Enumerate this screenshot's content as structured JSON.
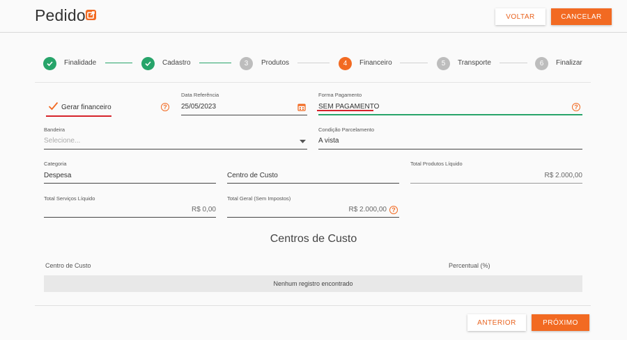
{
  "header": {
    "title": "Pedido",
    "back_label": "VOLTAR",
    "cancel_label": "CANCELAR"
  },
  "stepper": {
    "steps": [
      {
        "number": "1",
        "label": "Finalidade",
        "state": "done"
      },
      {
        "number": "2",
        "label": "Cadastro",
        "state": "done"
      },
      {
        "number": "3",
        "label": "Produtos",
        "state": "pending"
      },
      {
        "number": "4",
        "label": "Financeiro",
        "state": "active"
      },
      {
        "number": "5",
        "label": "Transporte",
        "state": "pending"
      },
      {
        "number": "6",
        "label": "Finalizar",
        "state": "pending"
      }
    ]
  },
  "form": {
    "gerar_financeiro": {
      "label": "Gerar financeiro",
      "checked": true
    },
    "data_referencia": {
      "label": "Data Referência",
      "value": "25/05/2023"
    },
    "forma_pagamento": {
      "label": "Forma Pagamento",
      "value": "SEM PAGAMENTO"
    },
    "bandeira": {
      "label": "Bandeira",
      "placeholder": "Selecione..."
    },
    "condicao_parcelamento": {
      "label": "Condição Parcelamento",
      "value": "A vista"
    },
    "categoria": {
      "label": "Categoria",
      "value": "Despesa"
    },
    "centro_custo": {
      "placeholder": "Centro de Custo"
    },
    "total_produtos": {
      "label": "Total Produtos Líquido",
      "value": "R$ 2.000,00"
    },
    "total_servicos": {
      "label": "Total Serviços Líquido",
      "value": "R$ 0,00"
    },
    "total_geral": {
      "label": "Total Geral (Sem Impostos)",
      "value": "R$ 2.000,00"
    }
  },
  "centros": {
    "title": "Centros de Custo",
    "columns": [
      "Centro de Custo",
      "Percentual (%)"
    ],
    "empty_text": "Nenhum registro encontrado"
  },
  "footer": {
    "prev_label": "ANTERIOR",
    "next_label": "PRÓXIMO"
  },
  "colors": {
    "accent": "#f26a22",
    "success": "#27a46a",
    "error_underline": "#d6232a"
  }
}
